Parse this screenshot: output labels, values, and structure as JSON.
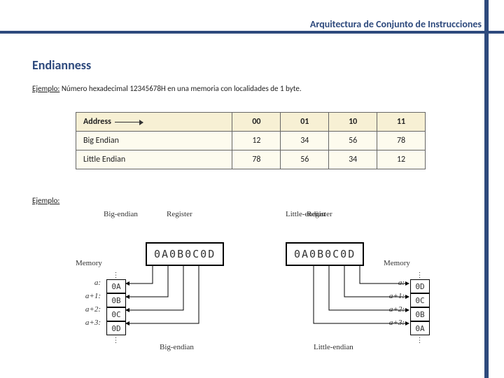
{
  "header": {
    "title": "Arquitectura de Conjunto de Instrucciones"
  },
  "heading": "Endianness",
  "example1": {
    "label": "Ejemplo:",
    "text_before": " Número hexadecimal ",
    "value": "12345678H",
    "text_after": " en una memoria con localidades de 1 byte."
  },
  "table1": {
    "addr_label": "Address",
    "cols": [
      "00",
      "01",
      "10",
      "11"
    ],
    "rows": [
      {
        "label": "Big Endian",
        "cells": [
          "12",
          "34",
          "56",
          "78"
        ]
      },
      {
        "label": "Little Endian",
        "cells": [
          "78",
          "56",
          "34",
          "12"
        ]
      }
    ]
  },
  "example2": {
    "label": "Ejemplo:"
  },
  "diagram": {
    "big": {
      "title": "Big-endian",
      "reg_label": "Register",
      "reg_value": "0A0B0C0D",
      "mem_label": "Memory",
      "addrs": [
        "a:",
        "a+1:",
        "a+2:",
        "a+3:"
      ],
      "cells": [
        "0A",
        "0B",
        "0C",
        "0D"
      ],
      "caption": "Big-endian"
    },
    "little": {
      "title": "Little-endian",
      "reg_label": "Register",
      "reg_value": "0A0B0C0D",
      "mem_label": "Memory",
      "addrs": [
        "a:",
        "a+1:",
        "a+2:",
        "a+3:"
      ],
      "cells": [
        "0D",
        "0C",
        "0B",
        "0A"
      ],
      "caption": "Little-endian"
    },
    "dots": "⋮"
  }
}
